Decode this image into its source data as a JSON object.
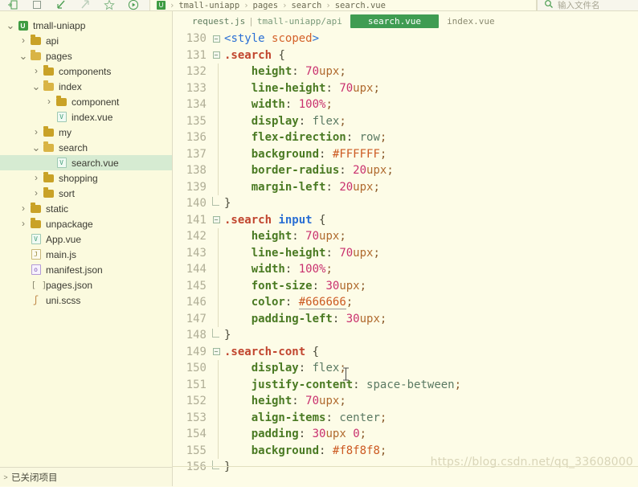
{
  "toolbar": {
    "icons": [
      {
        "name": "new-file-icon",
        "glyph": "new"
      },
      {
        "name": "stop-icon",
        "glyph": "square"
      },
      {
        "name": "back-arrow-icon",
        "glyph": "back"
      },
      {
        "name": "forward-arrow-icon",
        "glyph": "forward"
      },
      {
        "name": "bookmark-star-icon",
        "glyph": "star"
      },
      {
        "name": "run-icon",
        "glyph": "play"
      }
    ],
    "breadcrumb": {
      "project_badge": "U",
      "parts": [
        "tmall-uniapp",
        "pages",
        "search",
        "search.vue"
      ],
      "separator": "›"
    },
    "search": {
      "icon": "search-icon",
      "placeholder": "输入文件名"
    }
  },
  "sidebar": {
    "tree": [
      {
        "label": "tmall-uniapp",
        "depth": 0,
        "arrow": "v",
        "icon": "project",
        "icon_text": "U",
        "selected": false
      },
      {
        "label": "api",
        "depth": 1,
        "arrow": ">",
        "icon": "folder",
        "selected": false
      },
      {
        "label": "pages",
        "depth": 1,
        "arrow": "v",
        "icon": "folder-open",
        "selected": false
      },
      {
        "label": "components",
        "depth": 2,
        "arrow": ">",
        "icon": "folder",
        "selected": false
      },
      {
        "label": "index",
        "depth": 2,
        "arrow": "v",
        "icon": "folder-open",
        "selected": false
      },
      {
        "label": "component",
        "depth": 3,
        "arrow": ">",
        "icon": "folder",
        "selected": false
      },
      {
        "label": "index.vue",
        "depth": 3,
        "arrow": "",
        "icon": "vue",
        "icon_text": "V",
        "selected": false
      },
      {
        "label": "my",
        "depth": 2,
        "arrow": ">",
        "icon": "folder",
        "selected": false
      },
      {
        "label": "search",
        "depth": 2,
        "arrow": "v",
        "icon": "folder-open",
        "selected": false
      },
      {
        "label": "search.vue",
        "depth": 3,
        "arrow": "",
        "icon": "vue",
        "icon_text": "V",
        "selected": true
      },
      {
        "label": "shopping",
        "depth": 2,
        "arrow": ">",
        "icon": "folder",
        "selected": false
      },
      {
        "label": "sort",
        "depth": 2,
        "arrow": ">",
        "icon": "folder",
        "selected": false
      },
      {
        "label": "static",
        "depth": 1,
        "arrow": ">",
        "icon": "folder",
        "selected": false
      },
      {
        "label": "unpackage",
        "depth": 1,
        "arrow": ">",
        "icon": "folder",
        "selected": false
      },
      {
        "label": "App.vue",
        "depth": 1,
        "arrow": "",
        "icon": "vue",
        "icon_text": "V",
        "selected": false
      },
      {
        "label": "main.js",
        "depth": 1,
        "arrow": "",
        "icon": "js",
        "icon_text": "J",
        "selected": false
      },
      {
        "label": "manifest.json",
        "depth": 1,
        "arrow": "",
        "icon": "json",
        "icon_text": "o",
        "selected": false
      },
      {
        "label": "pages.json",
        "depth": 1,
        "arrow": "",
        "icon": "bracket",
        "icon_text": "[ ]",
        "selected": false
      },
      {
        "label": "uni.scss",
        "depth": 1,
        "arrow": "",
        "icon": "scss",
        "icon_text": "S",
        "selected": false
      }
    ],
    "footer": {
      "arrow": ">",
      "label": "已关闭项目"
    }
  },
  "editor": {
    "tabs": [
      {
        "name": "request.js",
        "path_divider": "|",
        "path": "tmall-uniapp/api",
        "active": false
      },
      {
        "name": "search.vue",
        "active": true
      },
      {
        "name": "index.vue",
        "active": false
      }
    ],
    "first_line_number": 130,
    "lines": [
      {
        "n": 130,
        "fold": "box",
        "indent": false,
        "tokens": [
          {
            "t": "t-punct",
            "v": "<"
          },
          {
            "t": "t-tag",
            "v": "style"
          },
          {
            "t": "plain",
            "v": " "
          },
          {
            "t": "t-attr",
            "v": "scoped"
          },
          {
            "t": "t-punct",
            "v": ">"
          }
        ]
      },
      {
        "n": 131,
        "fold": "box",
        "indent": false,
        "tokens": [
          {
            "t": "t-sel",
            "v": ".search"
          },
          {
            "t": "plain",
            "v": " "
          },
          {
            "t": "t-brace",
            "v": "{"
          }
        ]
      },
      {
        "n": 132,
        "fold": "",
        "indent": true,
        "tokens": [
          {
            "t": "plain",
            "v": "    "
          },
          {
            "t": "t-prop",
            "v": "height"
          },
          {
            "t": "t-brace",
            "v": ":"
          },
          {
            "t": "plain",
            "v": " "
          },
          {
            "t": "t-num",
            "v": "70"
          },
          {
            "t": "t-unit",
            "v": "upx"
          },
          {
            "t": "t-semi",
            "v": ";"
          }
        ]
      },
      {
        "n": 133,
        "fold": "",
        "indent": true,
        "tokens": [
          {
            "t": "plain",
            "v": "    "
          },
          {
            "t": "t-prop",
            "v": "line-height"
          },
          {
            "t": "t-brace",
            "v": ":"
          },
          {
            "t": "plain",
            "v": " "
          },
          {
            "t": "t-num",
            "v": "70"
          },
          {
            "t": "t-unit",
            "v": "upx"
          },
          {
            "t": "t-semi",
            "v": ";"
          }
        ]
      },
      {
        "n": 134,
        "fold": "",
        "indent": true,
        "tokens": [
          {
            "t": "plain",
            "v": "    "
          },
          {
            "t": "t-prop",
            "v": "width"
          },
          {
            "t": "t-brace",
            "v": ":"
          },
          {
            "t": "plain",
            "v": " "
          },
          {
            "t": "t-num",
            "v": "100"
          },
          {
            "t": "t-num",
            "v": "%"
          },
          {
            "t": "t-semi",
            "v": ";"
          }
        ]
      },
      {
        "n": 135,
        "fold": "",
        "indent": true,
        "tokens": [
          {
            "t": "plain",
            "v": "    "
          },
          {
            "t": "t-prop",
            "v": "display"
          },
          {
            "t": "t-brace",
            "v": ":"
          },
          {
            "t": "plain",
            "v": " "
          },
          {
            "t": "t-val",
            "v": "flex"
          },
          {
            "t": "t-semi",
            "v": ";"
          }
        ]
      },
      {
        "n": 136,
        "fold": "",
        "indent": true,
        "tokens": [
          {
            "t": "plain",
            "v": "    "
          },
          {
            "t": "t-prop",
            "v": "flex-direction"
          },
          {
            "t": "t-brace",
            "v": ":"
          },
          {
            "t": "plain",
            "v": " "
          },
          {
            "t": "t-val",
            "v": "row"
          },
          {
            "t": "t-semi",
            "v": ";"
          }
        ]
      },
      {
        "n": 137,
        "fold": "",
        "indent": true,
        "tokens": [
          {
            "t": "plain",
            "v": "    "
          },
          {
            "t": "t-prop",
            "v": "background"
          },
          {
            "t": "t-brace",
            "v": ":"
          },
          {
            "t": "plain",
            "v": " "
          },
          {
            "t": "t-colorp",
            "v": "#FFFFFF"
          },
          {
            "t": "t-semi",
            "v": ";"
          }
        ]
      },
      {
        "n": 138,
        "fold": "",
        "indent": true,
        "tokens": [
          {
            "t": "plain",
            "v": "    "
          },
          {
            "t": "t-prop",
            "v": "border-radius"
          },
          {
            "t": "t-brace",
            "v": ":"
          },
          {
            "t": "plain",
            "v": " "
          },
          {
            "t": "t-num",
            "v": "20"
          },
          {
            "t": "t-unit",
            "v": "upx"
          },
          {
            "t": "t-semi",
            "v": ";"
          }
        ]
      },
      {
        "n": 139,
        "fold": "",
        "indent": true,
        "tokens": [
          {
            "t": "plain",
            "v": "    "
          },
          {
            "t": "t-prop",
            "v": "margin-left"
          },
          {
            "t": "t-brace",
            "v": ":"
          },
          {
            "t": "plain",
            "v": " "
          },
          {
            "t": "t-num",
            "v": "20"
          },
          {
            "t": "t-unit",
            "v": "upx"
          },
          {
            "t": "t-semi",
            "v": ";"
          }
        ]
      },
      {
        "n": 140,
        "fold": "end",
        "indent": false,
        "tokens": [
          {
            "t": "t-brace",
            "v": "}"
          }
        ]
      },
      {
        "n": 141,
        "fold": "box",
        "indent": false,
        "tokens": [
          {
            "t": "t-sel",
            "v": ".search"
          },
          {
            "t": "plain",
            "v": " "
          },
          {
            "t": "t-el",
            "v": "input"
          },
          {
            "t": "plain",
            "v": " "
          },
          {
            "t": "t-brace",
            "v": "{"
          }
        ]
      },
      {
        "n": 142,
        "fold": "",
        "indent": true,
        "tokens": [
          {
            "t": "plain",
            "v": "    "
          },
          {
            "t": "t-prop",
            "v": "height"
          },
          {
            "t": "t-brace",
            "v": ":"
          },
          {
            "t": "plain",
            "v": " "
          },
          {
            "t": "t-num",
            "v": "70"
          },
          {
            "t": "t-unit",
            "v": "upx"
          },
          {
            "t": "t-semi",
            "v": ";"
          }
        ]
      },
      {
        "n": 143,
        "fold": "",
        "indent": true,
        "tokens": [
          {
            "t": "plain",
            "v": "    "
          },
          {
            "t": "t-prop",
            "v": "line-height"
          },
          {
            "t": "t-brace",
            "v": ":"
          },
          {
            "t": "plain",
            "v": " "
          },
          {
            "t": "t-num",
            "v": "70"
          },
          {
            "t": "t-unit",
            "v": "upx"
          },
          {
            "t": "t-semi",
            "v": ";"
          }
        ]
      },
      {
        "n": 144,
        "fold": "",
        "indent": true,
        "tokens": [
          {
            "t": "plain",
            "v": "    "
          },
          {
            "t": "t-prop",
            "v": "width"
          },
          {
            "t": "t-brace",
            "v": ":"
          },
          {
            "t": "plain",
            "v": " "
          },
          {
            "t": "t-num",
            "v": "100"
          },
          {
            "t": "t-num",
            "v": "%"
          },
          {
            "t": "t-semi",
            "v": ";"
          }
        ]
      },
      {
        "n": 145,
        "fold": "",
        "indent": true,
        "tokens": [
          {
            "t": "plain",
            "v": "    "
          },
          {
            "t": "t-prop",
            "v": "font-size"
          },
          {
            "t": "t-brace",
            "v": ":"
          },
          {
            "t": "plain",
            "v": " "
          },
          {
            "t": "t-num",
            "v": "30"
          },
          {
            "t": "t-unit",
            "v": "upx"
          },
          {
            "t": "t-semi",
            "v": ";"
          }
        ]
      },
      {
        "n": 146,
        "fold": "",
        "indent": true,
        "tokens": [
          {
            "t": "plain",
            "v": "    "
          },
          {
            "t": "t-prop",
            "v": "color"
          },
          {
            "t": "t-brace",
            "v": ":"
          },
          {
            "t": "plain",
            "v": " "
          },
          {
            "t": "t-color",
            "v": "#666666"
          },
          {
            "t": "t-semi",
            "v": ";"
          }
        ]
      },
      {
        "n": 147,
        "fold": "",
        "indent": true,
        "tokens": [
          {
            "t": "plain",
            "v": "    "
          },
          {
            "t": "t-prop",
            "v": "padding-left"
          },
          {
            "t": "t-brace",
            "v": ":"
          },
          {
            "t": "plain",
            "v": " "
          },
          {
            "t": "t-num",
            "v": "30"
          },
          {
            "t": "t-unit",
            "v": "upx"
          },
          {
            "t": "t-semi",
            "v": ";"
          }
        ]
      },
      {
        "n": 148,
        "fold": "end",
        "indent": false,
        "tokens": [
          {
            "t": "t-brace",
            "v": "}"
          }
        ]
      },
      {
        "n": 149,
        "fold": "box",
        "indent": false,
        "tokens": [
          {
            "t": "t-sel",
            "v": ".search-cont"
          },
          {
            "t": "plain",
            "v": " "
          },
          {
            "t": "t-brace",
            "v": "{"
          }
        ]
      },
      {
        "n": 150,
        "fold": "",
        "indent": true,
        "tokens": [
          {
            "t": "plain",
            "v": "    "
          },
          {
            "t": "t-prop",
            "v": "display"
          },
          {
            "t": "t-brace",
            "v": ":"
          },
          {
            "t": "plain",
            "v": " "
          },
          {
            "t": "t-val",
            "v": "flex"
          },
          {
            "t": "t-semi",
            "v": ";"
          }
        ]
      },
      {
        "n": 151,
        "fold": "",
        "indent": true,
        "tokens": [
          {
            "t": "plain",
            "v": "    "
          },
          {
            "t": "t-prop",
            "v": "justify-content"
          },
          {
            "t": "t-brace",
            "v": ":"
          },
          {
            "t": "plain",
            "v": " "
          },
          {
            "t": "t-val",
            "v": "space-between"
          },
          {
            "t": "t-semi",
            "v": ";"
          }
        ]
      },
      {
        "n": 152,
        "fold": "",
        "indent": true,
        "tokens": [
          {
            "t": "plain",
            "v": "    "
          },
          {
            "t": "t-prop",
            "v": "height"
          },
          {
            "t": "t-brace",
            "v": ":"
          },
          {
            "t": "plain",
            "v": " "
          },
          {
            "t": "t-num",
            "v": "70"
          },
          {
            "t": "t-unit",
            "v": "upx"
          },
          {
            "t": "t-semi",
            "v": ";"
          }
        ]
      },
      {
        "n": 153,
        "fold": "",
        "indent": true,
        "tokens": [
          {
            "t": "plain",
            "v": "    "
          },
          {
            "t": "t-prop",
            "v": "align-items"
          },
          {
            "t": "t-brace",
            "v": ":"
          },
          {
            "t": "plain",
            "v": " "
          },
          {
            "t": "t-val",
            "v": "center"
          },
          {
            "t": "t-semi",
            "v": ";"
          }
        ]
      },
      {
        "n": 154,
        "fold": "",
        "indent": true,
        "tokens": [
          {
            "t": "plain",
            "v": "    "
          },
          {
            "t": "t-prop",
            "v": "padding"
          },
          {
            "t": "t-brace",
            "v": ":"
          },
          {
            "t": "plain",
            "v": " "
          },
          {
            "t": "t-num",
            "v": "30"
          },
          {
            "t": "t-unit",
            "v": "upx"
          },
          {
            "t": "plain",
            "v": " "
          },
          {
            "t": "t-num",
            "v": "0"
          },
          {
            "t": "t-semi",
            "v": ";"
          }
        ]
      },
      {
        "n": 155,
        "fold": "",
        "indent": true,
        "tokens": [
          {
            "t": "plain",
            "v": "    "
          },
          {
            "t": "t-prop",
            "v": "background"
          },
          {
            "t": "t-brace",
            "v": ":"
          },
          {
            "t": "plain",
            "v": " "
          },
          {
            "t": "t-colorp",
            "v": "#f8f8f8"
          },
          {
            "t": "t-semi",
            "v": ";"
          }
        ]
      },
      {
        "n": 156,
        "fold": "end",
        "indent": false,
        "tokens": [
          {
            "t": "t-brace",
            "v": "}"
          }
        ]
      }
    ],
    "watermark": "https://blog.csdn.net/qq_33608000"
  }
}
